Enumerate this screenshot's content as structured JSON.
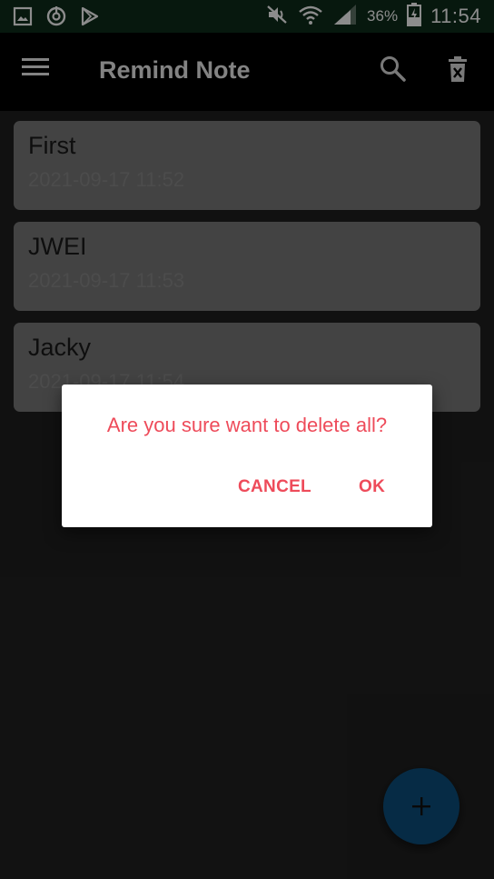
{
  "status_bar": {
    "battery_percent": "36%",
    "time": "11:54",
    "icons": [
      "gallery-icon",
      "sync-icon",
      "play-store-icon",
      "mute-icon",
      "wifi-icon",
      "signal-icon",
      "battery-charging-icon"
    ]
  },
  "app_bar": {
    "title": "Remind Note",
    "icons": [
      "menu-icon",
      "search-icon",
      "delete-all-icon"
    ]
  },
  "notes": [
    {
      "title": "First",
      "date": "2021-09-17 11:52"
    },
    {
      "title": "JWEI",
      "date": "2021-09-17 11:53"
    },
    {
      "title": "Jacky",
      "date": "2021-09-17 11:54"
    }
  ],
  "dialog": {
    "message": "Are you sure want to delete all?",
    "cancel_label": "CANCEL",
    "ok_label": "OK"
  },
  "fab": {
    "icon": "add-icon"
  },
  "colors": {
    "accent": "#ee4b5a",
    "fab": "#0b4f7e",
    "card": "#7a7a7a",
    "background": "#202020"
  }
}
